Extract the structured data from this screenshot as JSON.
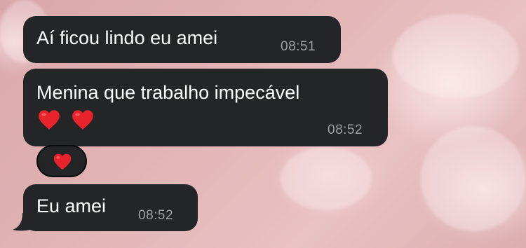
{
  "messages": [
    {
      "text": "Aí ficou lindo eu amei",
      "time": "08:51"
    },
    {
      "text": "Menina que trabalho impecável",
      "emoji": "❤️❤️",
      "time": "08:52"
    },
    {
      "text": "Eu amei",
      "time": "08:52"
    }
  ],
  "reaction": {
    "emoji": "❤️"
  },
  "colors": {
    "bubble": "#232526",
    "text": "#ffffff",
    "timestamp": "#9d9fa1",
    "heart": "#e8232c",
    "background": "#e2b4b6"
  }
}
